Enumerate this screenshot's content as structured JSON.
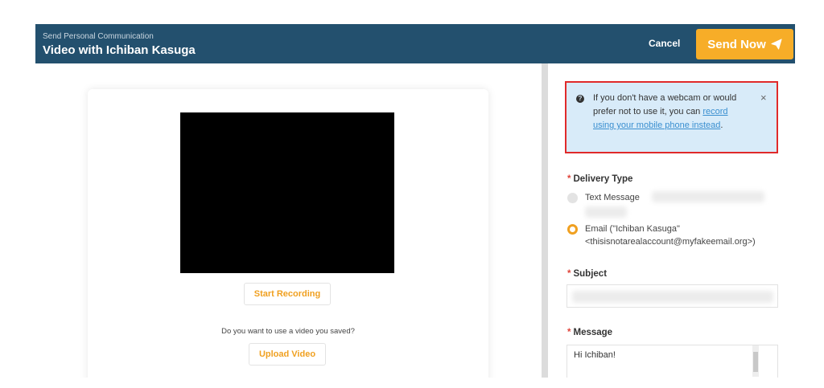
{
  "header": {
    "subtitle": "Send Personal Communication",
    "title": "Video with Ichiban Kasuga",
    "cancel_label": "Cancel",
    "send_label": "Send Now",
    "send_icon": "paper-plane-icon"
  },
  "recorder": {
    "start_label": "Start Recording",
    "saved_question": "Do you want to use a video you saved?",
    "upload_label": "Upload Video"
  },
  "alert": {
    "text_before": "If you don't have a webcam or would prefer not to use it, you can ",
    "link_text": "record using your mobile phone instead",
    "text_after": ".",
    "close_symbol": "×"
  },
  "form": {
    "delivery_label": "Delivery Type",
    "text_message_label": "Text Message",
    "email_label": "Email (\"Ichiban Kasuga\" <thisisnotarealaccount@myfakeemail.org>)",
    "email_selected": true,
    "subject_label": "Subject",
    "message_label": "Message",
    "message_value": "Hi Ichiban!",
    "required_marker": "*"
  },
  "colors": {
    "header_bg": "#23506e",
    "accent": "#f7ad28",
    "alert_bg": "#d8ebf9",
    "alert_border": "#e02a2a",
    "link": "#3a8fd0"
  }
}
